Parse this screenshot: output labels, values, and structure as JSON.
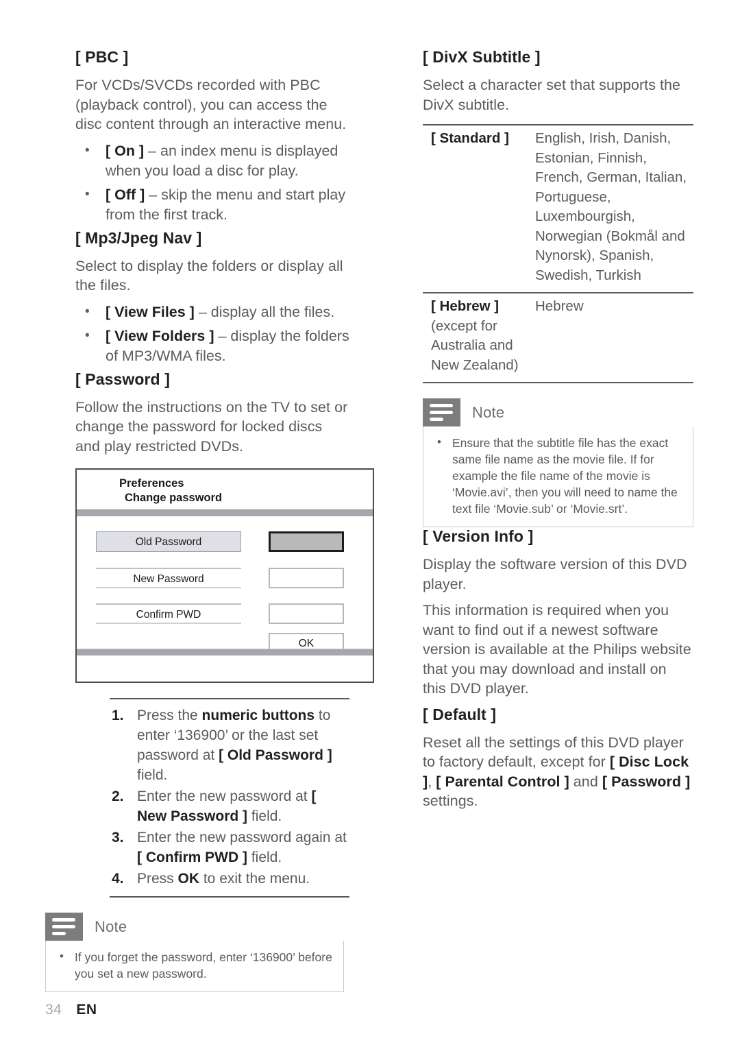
{
  "page": {
    "number": "34",
    "language_code": "EN"
  },
  "left_column": {
    "pbc": {
      "heading": "[ PBC ]",
      "paragraph": "For VCDs/SVCDs recorded with PBC (playback control), you can access the disc content through an interactive menu.",
      "options": [
        {
          "key": "[ On ]",
          "dash": " – ",
          "text": "an index menu is displayed when you load a disc for play."
        },
        {
          "key": "[ Off ]",
          "dash": " – ",
          "text": "skip the menu and start play from the first track."
        }
      ]
    },
    "mp3_jpeg_nav": {
      "heading": "[ Mp3/Jpeg Nav ]",
      "paragraph": "Select to display the folders or display all the files.",
      "options": [
        {
          "key": "[ View Files ]",
          "dash": " – ",
          "text": "display all the files."
        },
        {
          "key": "[ View Folders ]",
          "dash": " – ",
          "text": "display the folders of MP3/WMA files."
        }
      ]
    },
    "password": {
      "heading": "[ Password ]",
      "paragraph": "Follow the instructions on the TV to set or change the password for locked discs and play restricted DVDs."
    },
    "tv_screen": {
      "title_line1": "Preferences",
      "title_line2": "Change password",
      "rows": [
        {
          "label": "Old Password",
          "selected": true
        },
        {
          "label": "New Password",
          "selected": false
        },
        {
          "label": "Confirm PWD",
          "selected": false
        }
      ],
      "ok_button": "OK"
    },
    "steps": [
      {
        "num": "1.",
        "parts": [
          {
            "t": "Press the ",
            "b": false
          },
          {
            "t": "numeric buttons",
            "b": true
          },
          {
            "t": " to enter ‘136900’ or the last set password at ",
            "b": false
          },
          {
            "t": "[ Old Password ]",
            "b": true
          },
          {
            "t": " field.",
            "b": false
          }
        ]
      },
      {
        "num": "2.",
        "parts": [
          {
            "t": "Enter the new password at ",
            "b": false
          },
          {
            "t": "[ New Password ]",
            "b": true
          },
          {
            "t": " field.",
            "b": false
          }
        ]
      },
      {
        "num": "3.",
        "parts": [
          {
            "t": "Enter the new password again at ",
            "b": false
          },
          {
            "t": "[ Confirm PWD ]",
            "b": true
          },
          {
            "t": " field.",
            "b": false
          }
        ]
      },
      {
        "num": "4.",
        "parts": [
          {
            "t": "Press ",
            "b": false
          },
          {
            "t": "OK",
            "b": true
          },
          {
            "t": " to exit the menu.",
            "b": false
          }
        ]
      }
    ],
    "note": {
      "title": "Note",
      "icon": "note-lines-icon",
      "items": [
        "If you forget the password, enter ‘136900’ before you set a new password."
      ]
    }
  },
  "right_column": {
    "divx_subtitle": {
      "heading": "[ DivX Subtitle ]",
      "paragraph": "Select a character set that supports the DivX subtitle.",
      "table": {
        "rows": [
          {
            "key_bold": "[ Standard ]",
            "key_sub": "",
            "value": "English, Irish, Danish, Estonian, Finnish, French, German, Italian, Portuguese, Luxembourgish, Norwegian (Bokmål and Nynorsk), Spanish, Swedish, Turkish"
          },
          {
            "key_bold": "[ Hebrew ]",
            "key_sub": "(except for Australia and New Zealand)",
            "value": "Hebrew"
          }
        ]
      }
    },
    "note": {
      "title": "Note",
      "icon": "note-lines-icon",
      "items": [
        "Ensure that the subtitle file has the exact same file name as the movie file. If for example the file name of the movie is ‘Movie.avi’, then you will need to name the text file ‘Movie.sub’ or ‘Movie.srt’."
      ]
    },
    "version_info": {
      "heading": "[ Version Info ]",
      "paragraph1": "Display the software version of this DVD player.",
      "paragraph2": "This information is required when you want to find out if a newest software version is available at the Philips website that you may download and install on this DVD player."
    },
    "default": {
      "heading": "[ Default ]",
      "parts": [
        {
          "t": "Reset all the settings of this DVD player to factory default, except for ",
          "b": false
        },
        {
          "t": "[ Disc Lock ]",
          "b": true
        },
        {
          "t": ", ",
          "b": false
        },
        {
          "t": "[ Parental Control ]",
          "b": true
        },
        {
          "t": " and ",
          "b": false
        },
        {
          "t": "[ Password ]",
          "b": true
        },
        {
          "t": " settings.",
          "b": false
        }
      ]
    }
  },
  "colors": {
    "heading": "#231f20",
    "body_text": "#5b5b5e",
    "note_icon_bg": "#7c7c7e",
    "note_border": "#c9c9cb",
    "rule": "#58585b",
    "tv_bar": "#a6a6ac",
    "tv_selected_field": "#dfe0e6",
    "tv_active_input": "#b9b9b9"
  }
}
